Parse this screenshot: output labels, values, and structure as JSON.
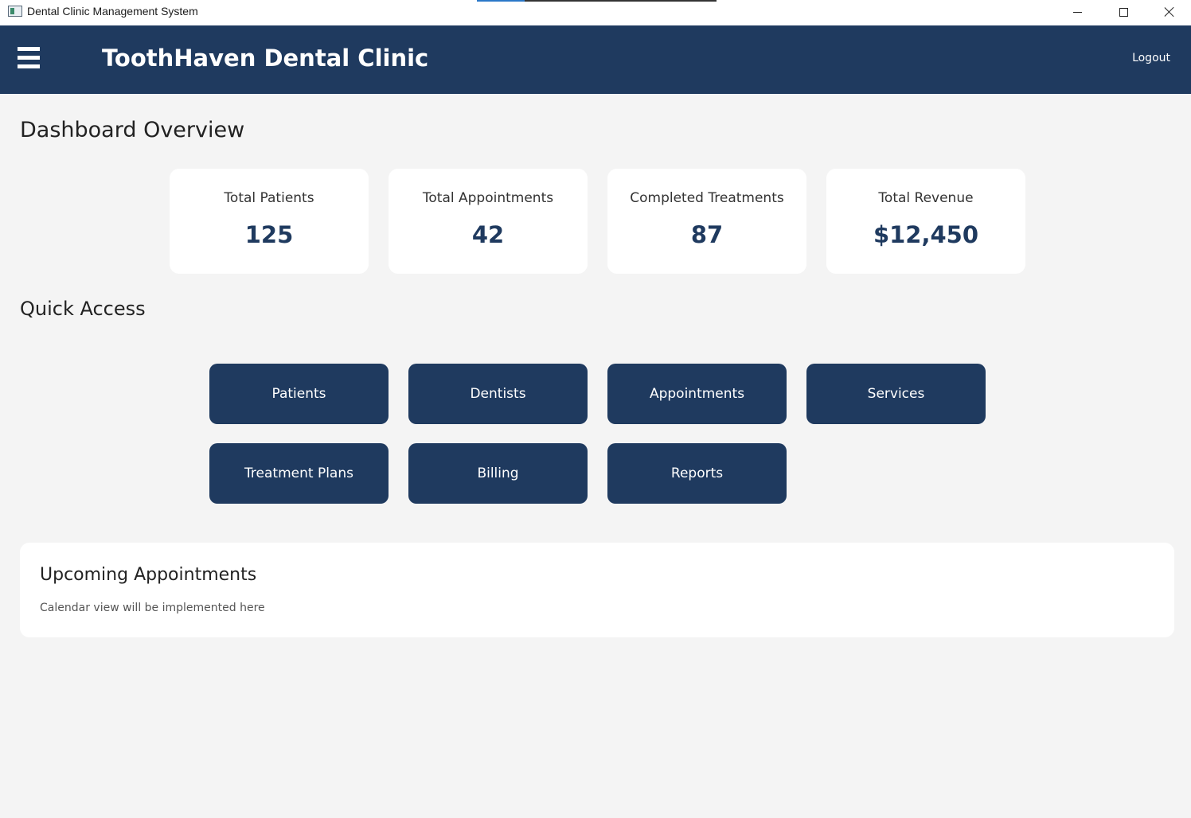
{
  "window": {
    "title": "Dental Clinic Management System",
    "controls": {
      "minimize": "minimize-icon",
      "maximize": "maximize-icon",
      "close": "close-icon"
    }
  },
  "header": {
    "menu_icon": "hamburger-menu-icon",
    "clinic_name": "ToothHaven Dental Clinic",
    "logout_label": "Logout",
    "background_color": "#1f3a5f"
  },
  "dashboard": {
    "title": "Dashboard Overview",
    "stats": [
      {
        "label": "Total Patients",
        "value": "125"
      },
      {
        "label": "Total Appointments",
        "value": "42"
      },
      {
        "label": "Completed Treatments",
        "value": "87"
      },
      {
        "label": "Total Revenue",
        "value": "$12,450"
      }
    ]
  },
  "quick_access": {
    "title": "Quick Access",
    "buttons": [
      {
        "label": "Patients"
      },
      {
        "label": "Dentists"
      },
      {
        "label": "Appointments"
      },
      {
        "label": "Services"
      },
      {
        "label": "Treatment Plans"
      },
      {
        "label": "Billing"
      },
      {
        "label": "Reports"
      }
    ]
  },
  "upcoming_appointments": {
    "title": "Upcoming Appointments",
    "placeholder_text": "Calendar view will be implemented here"
  },
  "colors": {
    "primary": "#1f3a5f",
    "background": "#f4f4f4",
    "card": "#ffffff"
  }
}
